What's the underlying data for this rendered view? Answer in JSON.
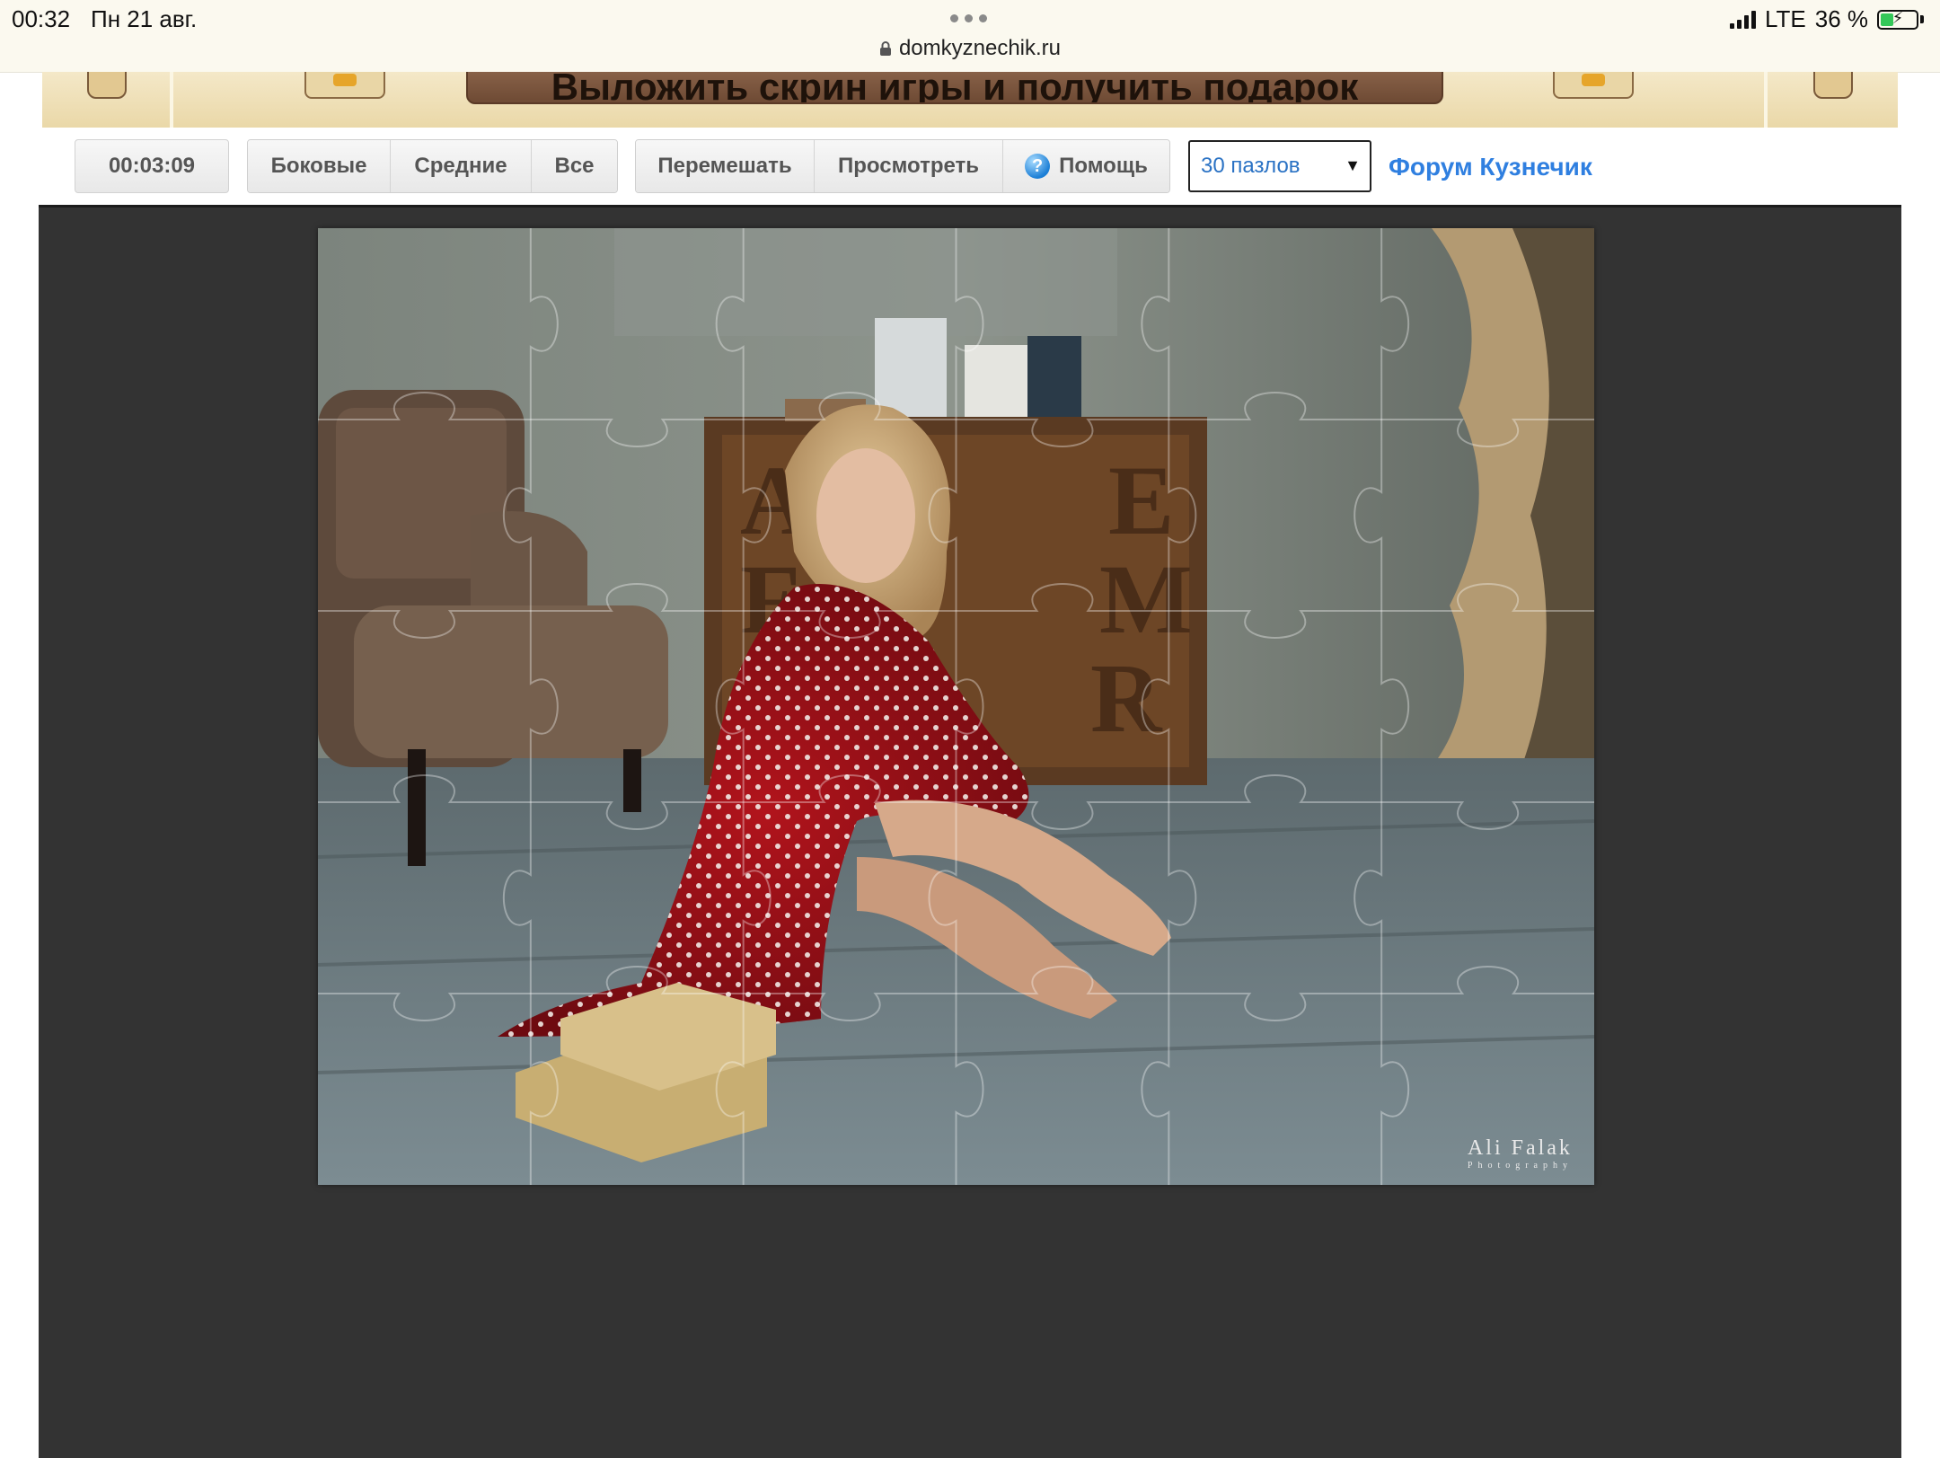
{
  "status_bar": {
    "time": "00:32",
    "date": "Пн 21 авг.",
    "url": "domkyznechik.ru",
    "network": "LTE",
    "battery": "36 %",
    "battery_level": 0.36
  },
  "banner": {
    "text": "Выложить скрин игры и получить подарок"
  },
  "toolbar": {
    "timer": "00:03:09",
    "filter_buttons": [
      "Боковые",
      "Средние",
      "Все"
    ],
    "action_buttons": {
      "shuffle": "Перемешать",
      "preview": "Просмотреть",
      "help": "Помощь"
    },
    "pieces_select": "30 пазлов",
    "forum_link": "Форум Кузнечик"
  },
  "puzzle": {
    "watermark": "Ali Falak",
    "watermark_sub": "Photography",
    "grid": {
      "columns": 6,
      "rows": 5
    }
  },
  "colors": {
    "accent_link": "#2f7fe0",
    "select_text": "#2a72c4",
    "puzzle_background": "#333333",
    "banner": "#ead8a8"
  }
}
